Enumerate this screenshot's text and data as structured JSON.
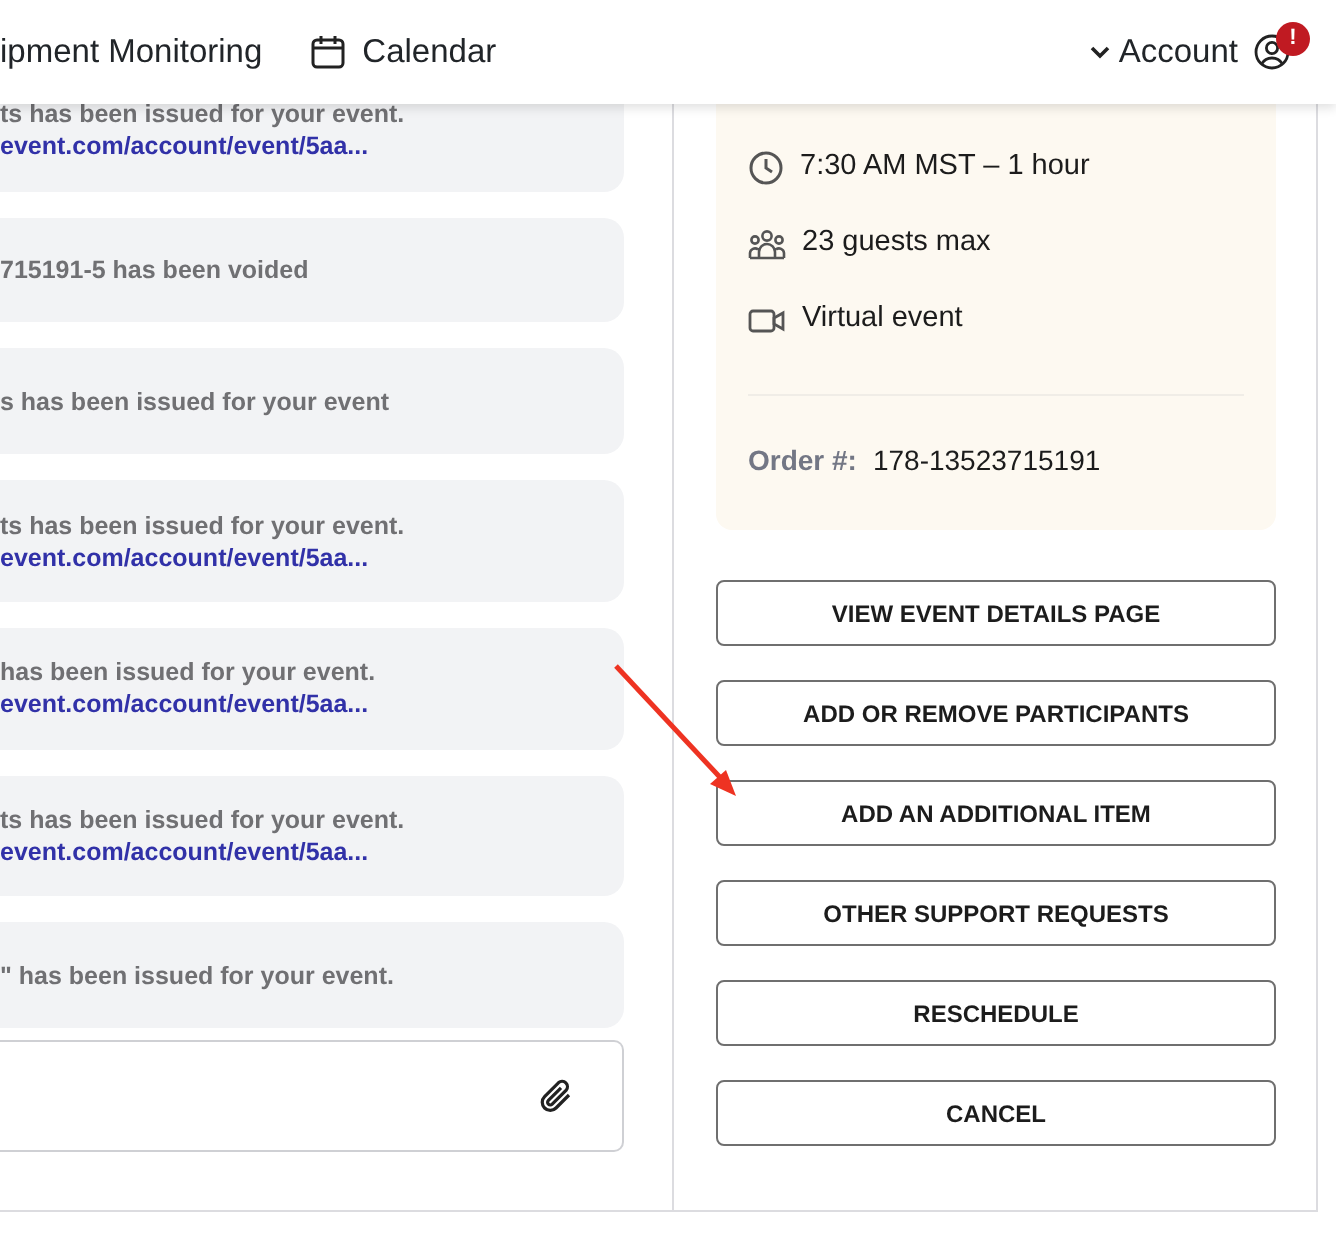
{
  "nav": {
    "items": [
      {
        "label": "ipment Monitoring",
        "kind": "plain"
      },
      {
        "label": "Calendar",
        "kind": "calendar"
      }
    ],
    "account": {
      "label": "Account",
      "alert": "!"
    }
  },
  "messages": [
    {
      "text": "ts has been issued for your event.",
      "link": "event.com/account/event/5aa..."
    },
    {
      "text": "715191-5 has been voided"
    },
    {
      "text": "s has been issued for your event"
    },
    {
      "text": "ts has been issued for your event.",
      "link": "event.com/account/event/5aa..."
    },
    {
      "text": "has been issued for your event.",
      "link": "event.com/account/event/5aa..."
    },
    {
      "text": "ts has been issued for your event.",
      "link": "event.com/account/event/5aa..."
    },
    {
      "text": "\" has been issued for your event."
    }
  ],
  "event": {
    "details": [
      {
        "kind": "clock",
        "text": "7:30 AM MST – 1 hour"
      },
      {
        "kind": "guests",
        "text": "23 guests max"
      },
      {
        "kind": "video",
        "text": "Virtual event"
      }
    ],
    "order_label": "Order #:",
    "order_number": "178-13523715191"
  },
  "actions": [
    "VIEW EVENT DETAILS PAGE",
    "ADD OR REMOVE PARTICIPANTS",
    "ADD AN ADDITIONAL ITEM",
    "OTHER SUPPORT REQUESTS",
    "RESCHEDULE",
    "CANCEL"
  ]
}
